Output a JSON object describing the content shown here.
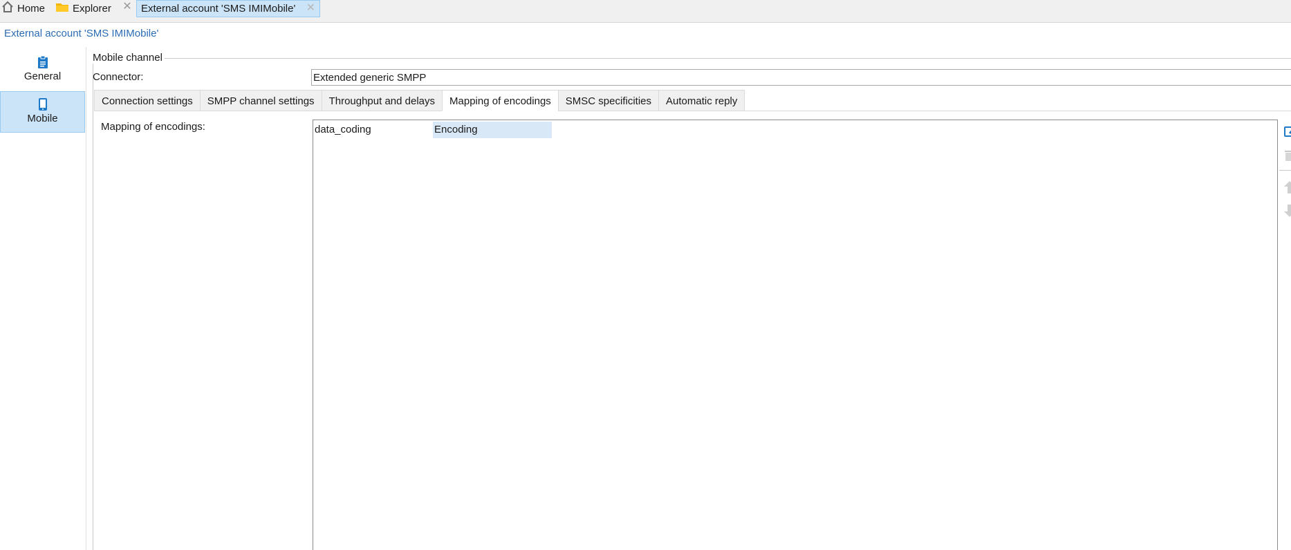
{
  "tabs": {
    "home": "Home",
    "explorer": "Explorer",
    "close_glyph": "✕",
    "active": "External account 'SMS IMIMobile'"
  },
  "breadcrumb": "External account 'SMS IMIMobile'",
  "nav": {
    "general": "General",
    "mobile": "Mobile"
  },
  "form": {
    "group_title": "Mobile channel",
    "connector_label": "Connector:",
    "connector_value": "Extended generic SMPP"
  },
  "subtabs": [
    "Connection settings",
    "SMPP channel settings",
    "Throughput and delays",
    "Mapping of encodings",
    "SMSC specificities",
    "Automatic reply"
  ],
  "mapping": {
    "label": "Mapping of encodings:",
    "columns": [
      "data_coding",
      "Encoding"
    ]
  },
  "colors": {
    "accent": "#1e7ac8",
    "selected_bg": "#cce4f7",
    "link": "#2b6cb4"
  },
  "icons": [
    "home-icon",
    "folder-icon",
    "clipboard-icon",
    "mobile-phone-icon",
    "edit-icon",
    "delete-icon",
    "move-up-icon",
    "move-down-icon"
  ]
}
